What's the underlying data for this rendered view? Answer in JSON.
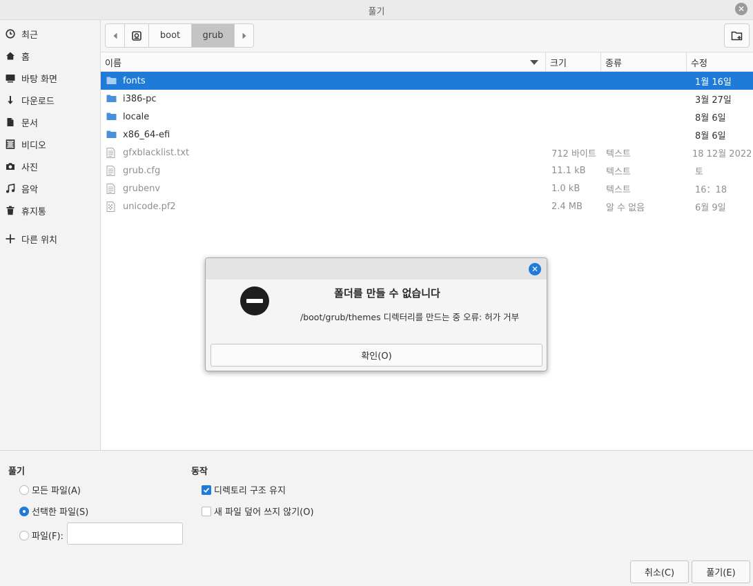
{
  "window": {
    "title": "풀기"
  },
  "sidebar": {
    "items": [
      {
        "label": "최근",
        "icon": "clock-icon"
      },
      {
        "label": "홈",
        "icon": "home-icon"
      },
      {
        "label": "바탕 화면",
        "icon": "desktop-icon"
      },
      {
        "label": "다운로드",
        "icon": "download-icon"
      },
      {
        "label": "문서",
        "icon": "document-icon"
      },
      {
        "label": "비디오",
        "icon": "video-icon"
      },
      {
        "label": "사진",
        "icon": "camera-icon"
      },
      {
        "label": "음악",
        "icon": "music-icon"
      },
      {
        "label": "휴지통",
        "icon": "trash-icon"
      }
    ],
    "other_locations": {
      "label": "다른 위치",
      "icon": "plus-icon"
    }
  },
  "pathbar": {
    "segments": [
      "boot",
      "grub"
    ],
    "active": "grub"
  },
  "columns": {
    "name": "이름",
    "size": "크기",
    "type": "종류",
    "modified": "수정"
  },
  "files": [
    {
      "name": "fonts",
      "size": "",
      "type": "",
      "modified": "1월 16일",
      "kind": "folder",
      "selected": true
    },
    {
      "name": "i386-pc",
      "size": "",
      "type": "",
      "modified": "3월 27일",
      "kind": "folder"
    },
    {
      "name": "locale",
      "size": "",
      "type": "",
      "modified": "8월 6일",
      "kind": "folder"
    },
    {
      "name": "x86_64-efi",
      "size": "",
      "type": "",
      "modified": "8월 6일",
      "kind": "folder"
    },
    {
      "name": "gfxblacklist.txt",
      "size": "712 바이트",
      "type": "텍스트",
      "modified": "18 12월 2022",
      "kind": "text"
    },
    {
      "name": "grub.cfg",
      "size": "11.1 kB",
      "type": "텍스트",
      "modified": "토",
      "kind": "text"
    },
    {
      "name": "grubenv",
      "size": "1.0 kB",
      "type": "텍스트",
      "modified": "16：18",
      "kind": "text"
    },
    {
      "name": "unicode.pf2",
      "size": "2.4 MB",
      "type": "알 수 없음",
      "modified": "6월 9일",
      "kind": "binary"
    }
  ],
  "extract": {
    "title": "풀기",
    "all_files": "모든 파일(A)",
    "selected_files": "선택한 파일(S)",
    "files": "파일(F):",
    "files_value": "",
    "selection": "selected_files"
  },
  "actions": {
    "title": "동작",
    "keep_structure": "디렉토리 구조 유지",
    "keep_structure_checked": true,
    "no_overwrite": "새 파일 덮어 쓰지 않기(O)",
    "no_overwrite_checked": false
  },
  "buttons": {
    "cancel": "취소(C)",
    "extract": "풀기(E)"
  },
  "error_dialog": {
    "title": "폴더를 만들 수 없습니다",
    "message": "/boot/grub/themes 디렉터리를 만드는 중 오류: 허가 거부",
    "ok": "확인(O)"
  },
  "colors": {
    "accent": "#1f7bd8",
    "folder": "#4a90d9"
  }
}
